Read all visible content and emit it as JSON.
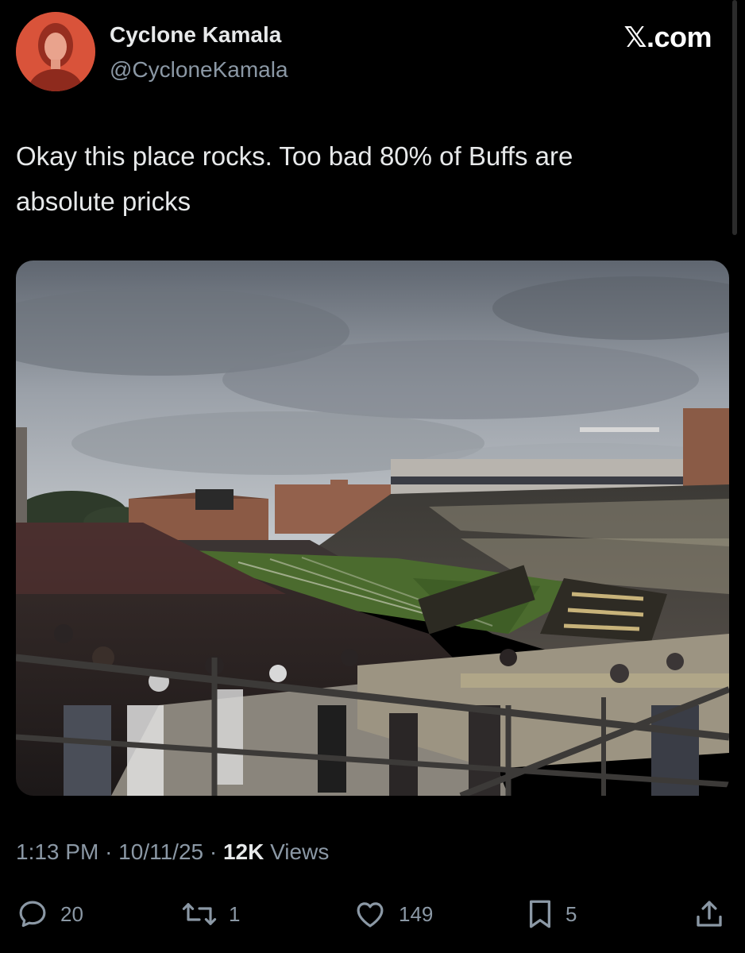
{
  "tweet": {
    "author": {
      "display_name": "Cyclone Kamala",
      "handle": "@CycloneKamala"
    },
    "watermark": {
      "x_glyph": "𝕏",
      "domain": ".com"
    },
    "text_line1": "Okay this place rocks. Too bad 80% of Buffs are",
    "text_line2": "absolute pricks",
    "media": {
      "description": "Photo of a football stadium"
    },
    "meta": {
      "time": "1:13 PM",
      "separator": "·",
      "date": "10/11/25",
      "views_count": "12K",
      "views_label": "Views"
    },
    "actions": {
      "reply_count": "20",
      "repost_count": "1",
      "like_count": "149",
      "bookmark_count": "5"
    }
  },
  "icons": {
    "reply": "reply-icon",
    "repost": "repost-icon",
    "like": "heart-icon",
    "bookmark": "bookmark-icon",
    "share": "share-icon"
  },
  "colors": {
    "background": "#000000",
    "primary_text": "#e7e9ea",
    "secondary_text": "#8b98a5",
    "avatar_tint": "#d9533a"
  }
}
